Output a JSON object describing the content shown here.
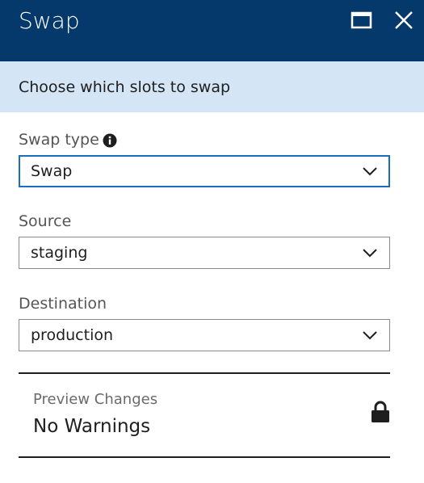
{
  "window": {
    "title": "Swap",
    "maximize_icon": "maximize-icon",
    "close_icon": "close-icon"
  },
  "banner": {
    "text": "Choose which slots to swap"
  },
  "form": {
    "swap_type": {
      "label": "Swap type",
      "info_icon": "info-icon",
      "value": "Swap"
    },
    "source": {
      "label": "Source",
      "value": "staging"
    },
    "destination": {
      "label": "Destination",
      "value": "production"
    }
  },
  "preview": {
    "label": "Preview Changes",
    "value": "No Warnings",
    "icon": "lock-icon"
  },
  "colors": {
    "titlebar": "#05386b",
    "banner": "#d4e6f6",
    "focus_border": "#1a6ec0"
  }
}
